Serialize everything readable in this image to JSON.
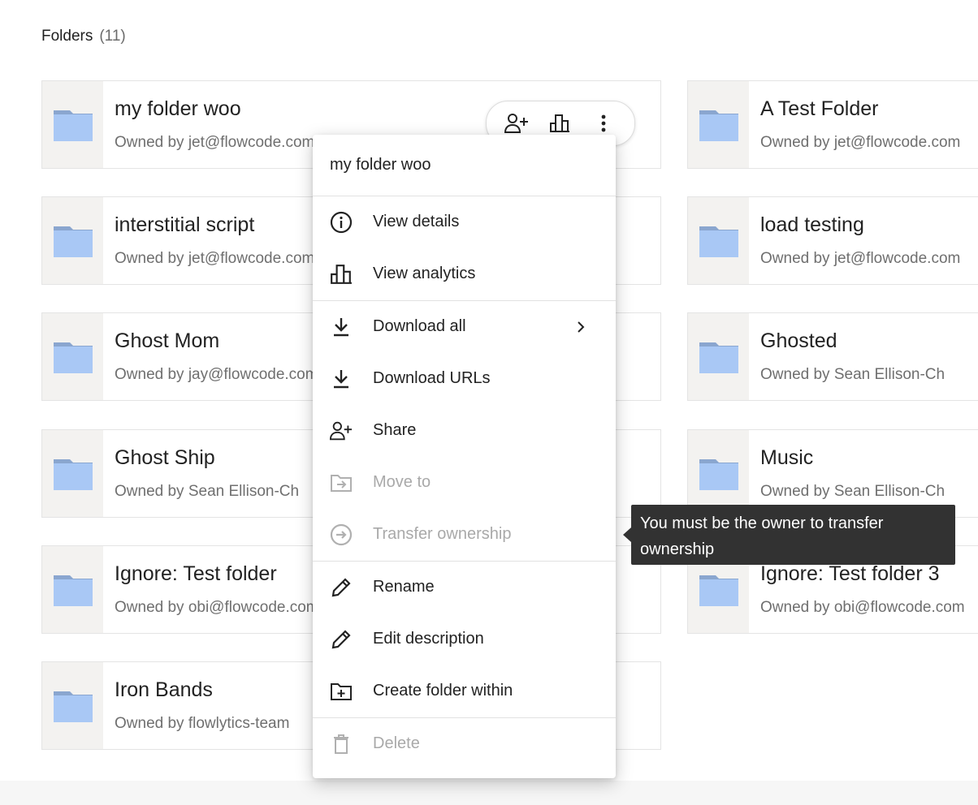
{
  "section": {
    "title": "Folders",
    "count": "(11)"
  },
  "folders": [
    {
      "name": "my folder woo",
      "owner": "Owned by jet@flowcode.com"
    },
    {
      "name": "A Test Folder",
      "owner": "Owned by jet@flowcode.com"
    },
    {
      "name": "interstitial script",
      "owner": "Owned by jet@flowcode.com"
    },
    {
      "name": "load testing",
      "owner": "Owned by jet@flowcode.com"
    },
    {
      "name": "Ghost Mom",
      "owner": "Owned by jay@flowcode.com"
    },
    {
      "name": "Ghosted",
      "owner": "Owned by Sean Ellison-Ch"
    },
    {
      "name": "Ghost Ship",
      "owner": "Owned by Sean Ellison-Ch"
    },
    {
      "name": "Music",
      "owner": "Owned by Sean Ellison-Ch"
    },
    {
      "name": "Ignore: Test folder",
      "owner": "Owned by obi@flowcode.com"
    },
    {
      "name": "Ignore: Test folder 3",
      "owner": "Owned by obi@flowcode.com"
    },
    {
      "name": "Iron Bands",
      "owner": "Owned by flowlytics-team"
    }
  ],
  "card_actions": {
    "icons": [
      "person-add-icon",
      "bar-chart-icon",
      "more-vertical-icon"
    ]
  },
  "menu": {
    "title": "my folder woo",
    "items": [
      {
        "label": "View details",
        "icon": "info-icon",
        "enabled": true
      },
      {
        "label": "View analytics",
        "icon": "bar-chart-icon",
        "enabled": true
      },
      {
        "label": "Download all",
        "icon": "download-icon",
        "enabled": true,
        "submenu": true
      },
      {
        "label": "Download URLs",
        "icon": "download-icon",
        "enabled": true
      },
      {
        "label": "Share",
        "icon": "person-add-icon",
        "enabled": true
      },
      {
        "label": "Move to",
        "icon": "folder-move-icon",
        "enabled": false
      },
      {
        "label": "Transfer ownership",
        "icon": "arrow-circle-icon",
        "enabled": false
      },
      {
        "label": "Rename",
        "icon": "pencil-icon",
        "enabled": true
      },
      {
        "label": "Edit description",
        "icon": "pencil-icon",
        "enabled": true
      },
      {
        "label": "Create folder within",
        "icon": "folder-add-icon",
        "enabled": true
      },
      {
        "label": "Delete",
        "icon": "trash-icon",
        "enabled": false
      }
    ]
  },
  "tooltip": {
    "text": "You must be the owner to transfer ownership"
  },
  "colors": {
    "folder": "#a9c8f5",
    "folder_tab": "#8aa6cf",
    "tooltip_bg": "#323232",
    "disabled_text": "#a9a9a9"
  }
}
